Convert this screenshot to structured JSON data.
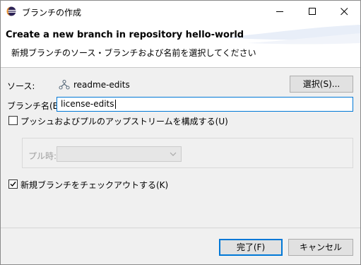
{
  "window": {
    "title": "ブランチの作成",
    "icons": {
      "app": "eclipse-icon",
      "minimize": "minimize-icon",
      "maximize": "maximize-icon",
      "close": "close-icon"
    }
  },
  "banner": {
    "title": "Create a new branch in repository hello-world",
    "description": "新規ブランチのソース・ブランチおよび名前を選択してください"
  },
  "source": {
    "label": "ソース:",
    "icon": "git-branch-icon",
    "value": "readme-edits",
    "select_button": "選択(S)..."
  },
  "branch_name": {
    "label": "ブランチ名(B):",
    "value": "license-edits"
  },
  "push_pull": {
    "label": "プッシュおよびプルのアップストリームを構成する(U)",
    "checked": false
  },
  "pull": {
    "label": "プル時:",
    "value": "",
    "enabled": false
  },
  "checkout": {
    "label": "新規ブランチをチェックアウトする(K)",
    "checked": true
  },
  "buttons": {
    "finish": "完了(F)",
    "cancel": "キャンセル"
  },
  "colors": {
    "focus": "#0078d7",
    "dialog_bg": "#f0f0f0",
    "banner_bg": "#ffffff"
  }
}
